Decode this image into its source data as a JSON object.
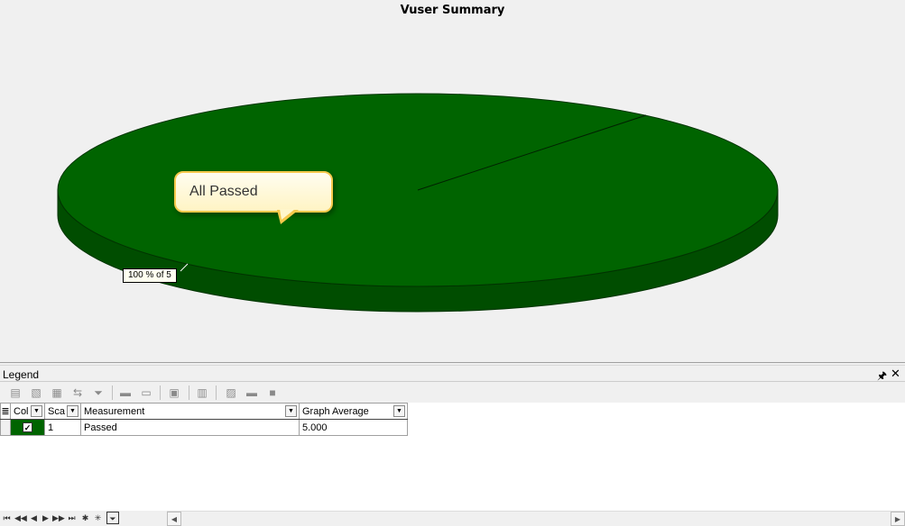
{
  "chart_data": {
    "type": "pie",
    "title": "Vuser Summary",
    "slices": [
      {
        "label": "All Passed",
        "value": 100,
        "color": "#006400"
      }
    ],
    "slice_label": "100 % of 5",
    "callout": "All Passed"
  },
  "legend": {
    "title": "Legend",
    "pin_icon": "pin-icon",
    "close_icon": "close-icon",
    "columns": {
      "color": "Col",
      "scale": "Sca",
      "measurement": "Measurement",
      "graph_average": "Graph Average"
    },
    "rows": [
      {
        "color": "#006400",
        "checked": true,
        "scale": "1",
        "measurement": "Passed",
        "graph_average": "5.000"
      }
    ]
  },
  "colors": {
    "pie_top": "#006400",
    "pie_side": "#004d00",
    "callout_border": "#f6c94d"
  }
}
